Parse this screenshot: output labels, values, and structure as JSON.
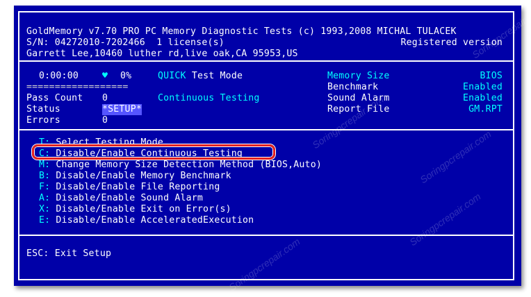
{
  "header": {
    "line1": "GoldMemory v7.70 PRO PC Memory Diagnostic Tests (c) 1993,2008 MICHAL TULACEK",
    "serial": "S/N: 04272010-7202466  1 license(s)",
    "registered": "Registered version",
    "address": "Garrett Lee,10460 luther rd,live oak,CA 95953,US"
  },
  "status_panel": {
    "time": "0:00:00",
    "heart": "♥",
    "percent": "0%",
    "mode_quick": "QUICK",
    "mode_rest": " Test Mode",
    "progress_bar": "==================",
    "continuous": "Continuous Testing",
    "pass_count_label": "Pass Count",
    "pass_count_value": "0",
    "status_label": "Status",
    "status_value": "*SETUP*",
    "errors_label": "Errors",
    "errors_value": "0"
  },
  "settings": [
    {
      "label": "Memory Size",
      "value": "BIOS"
    },
    {
      "label": "Benchmark",
      "value": "Enabled"
    },
    {
      "label": "Sound Alarm",
      "value": "Enabled"
    },
    {
      "label": "Report File",
      "value": "GM.RPT"
    }
  ],
  "menu": [
    {
      "key": "T:",
      "label": "Select Testing Mode"
    },
    {
      "key": "C:",
      "label": "Disable/Enable Continuous Testing"
    },
    {
      "key": "M:",
      "label": "Change Memory Size Detection Method (BIOS,Auto)"
    },
    {
      "key": "B:",
      "label": "Disable/Enable Memory Benchmark"
    },
    {
      "key": "F:",
      "label": "Disable/Enable File Reporting"
    },
    {
      "key": "A:",
      "label": "Disable/Enable Sound Alarm"
    },
    {
      "key": "X:",
      "label": "Disable/Enable Exit on Error(s)"
    },
    {
      "key": "E:",
      "label": "Disable/Enable AcceleratedExecution"
    }
  ],
  "footer": {
    "esc": "ESC: Exit Setup"
  },
  "watermark": "Soringpcrepair.com",
  "colors": {
    "background": "#0000a8",
    "text": "#ffffff",
    "accent": "#00ffff",
    "highlight_border": "#e02020"
  }
}
